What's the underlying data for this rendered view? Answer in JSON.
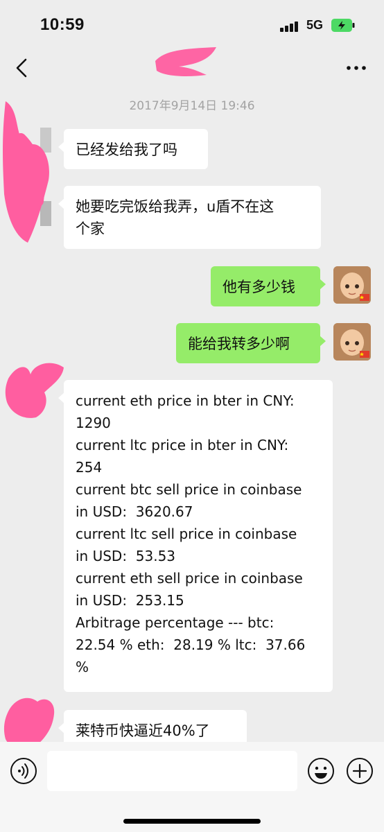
{
  "status_bar": {
    "time": "10:59",
    "network": "5G"
  },
  "nav": {
    "back_icon": "chevron-left-icon",
    "more_icon": "ellipsis-icon",
    "title_redacted": true
  },
  "timestamp": "2017年9月14日 19:46",
  "messages": [
    {
      "side": "in",
      "lines": [
        "已经发给我了吗"
      ]
    },
    {
      "side": "in",
      "lines": [
        "她要吃完饭给我弄，u盾不在这",
        "个家"
      ]
    },
    {
      "side": "out",
      "lines": [
        "他有多少钱"
      ]
    },
    {
      "side": "out",
      "lines": [
        "能给我转多少啊"
      ]
    },
    {
      "side": "in",
      "lines": [
        "current eth price in bter in CNY:",
        "1290",
        "current ltc price in bter in CNY:",
        "254",
        "current btc sell price in coinbase",
        "in USD:  3620.67",
        "current ltc sell price in coinbase",
        "in USD:  53.53",
        "current eth sell price in coinbase",
        "in USD:  253.15",
        "Arbitrage percentage --- btc:",
        "22.54 % eth:  28.19 % ltc:  37.66",
        "%"
      ]
    },
    {
      "side": "in",
      "lines": [
        "莱特币快逼近40%了"
      ]
    }
  ],
  "input_bar": {
    "value": "",
    "placeholder": ""
  },
  "colors": {
    "background": "#ededed",
    "incoming_bubble": "#ffffff",
    "outgoing_bubble": "#95ec69",
    "redaction": "#ff5ea0",
    "battery": "#4cd964"
  }
}
